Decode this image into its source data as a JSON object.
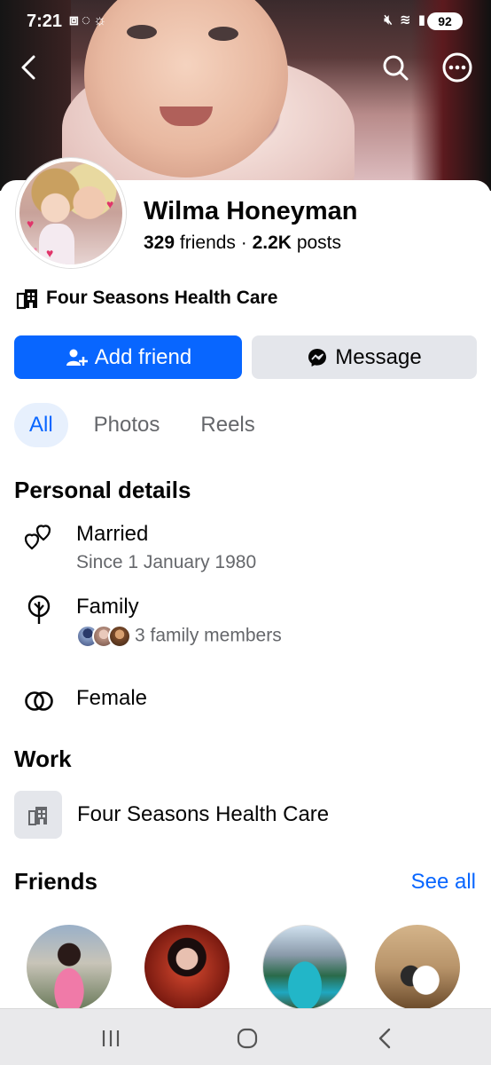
{
  "status_bar": {
    "time": "7:21",
    "battery": "92",
    "left_icons": [
      "screenshot-icon",
      "whatsapp-icon",
      "brightness-icon"
    ],
    "right_icons": [
      "mute-icon",
      "wifi-icon",
      "signal-icon"
    ]
  },
  "profile": {
    "name": "Wilma Honeyman",
    "friends_count": "329",
    "friends_label": "friends",
    "separator": "·",
    "posts_count": "2.2K",
    "posts_label": "posts",
    "workplace": "Four Seasons Health Care"
  },
  "actions": {
    "add_friend": "Add friend",
    "message": "Message"
  },
  "tabs": [
    {
      "label": "All",
      "active": true
    },
    {
      "label": "Photos",
      "active": false
    },
    {
      "label": "Reels",
      "active": false
    }
  ],
  "personal_details": {
    "title": "Personal details",
    "relationship": {
      "label": "Married",
      "sub": "Since 1 January 1980"
    },
    "family": {
      "label": "Family",
      "sub": "3 family members"
    },
    "gender": {
      "label": "Female"
    }
  },
  "work": {
    "title": "Work",
    "employer": "Four Seasons Health Care"
  },
  "friends": {
    "title": "Friends",
    "see_all": "See all"
  },
  "colors": {
    "primary": "#0866ff",
    "secondary_button": "#e4e6eb",
    "active_tab_bg": "#e7f0fd",
    "muted_text": "#65676b"
  }
}
